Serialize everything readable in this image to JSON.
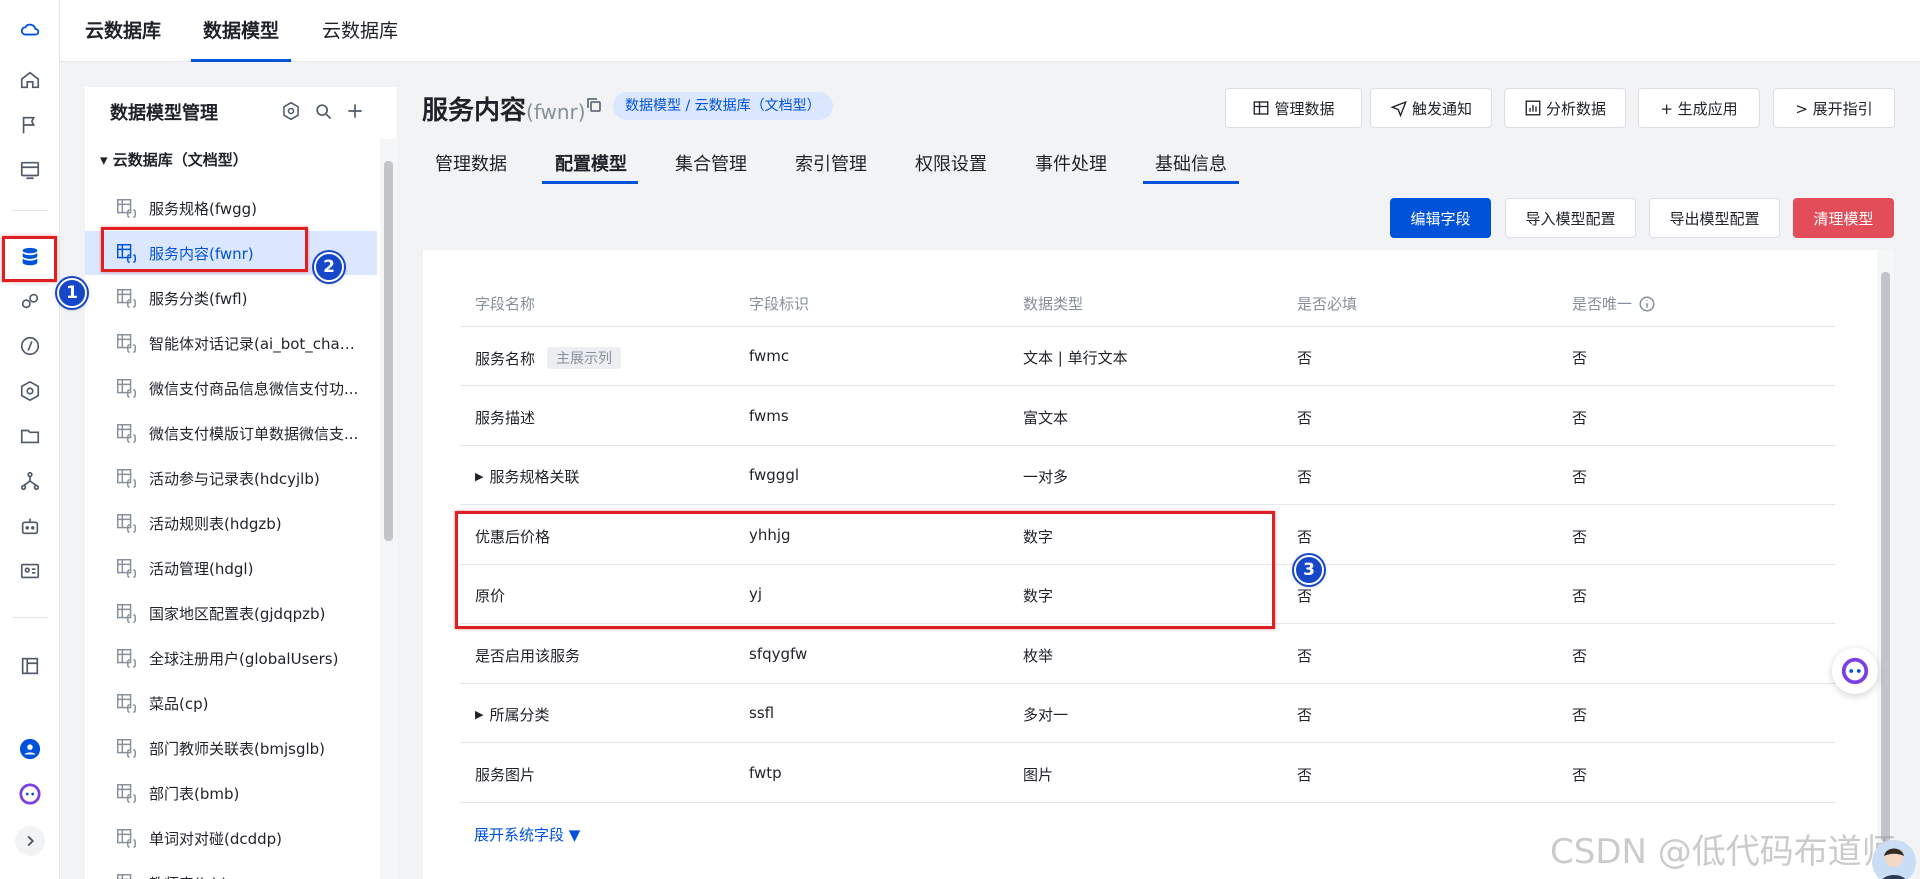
{
  "topbar": {
    "tabs": [
      {
        "label": "云数据库",
        "bold": true
      },
      {
        "label": "数据模型",
        "active": true
      },
      {
        "label": "云数据库"
      }
    ]
  },
  "tree": {
    "title": "数据模型管理",
    "root": "云数据库（文档型）",
    "items": [
      {
        "label": "服务规格(fwgg)"
      },
      {
        "label": "服务内容(fwnr)",
        "selected": true
      },
      {
        "label": "服务分类(fwfl)"
      },
      {
        "label": "智能体对话记录(ai_bot_chat_..."
      },
      {
        "label": "微信支付商品信息微信支付功..."
      },
      {
        "label": "微信支付模版订单数据微信支..."
      },
      {
        "label": "活动参与记录表(hdcyjlb)"
      },
      {
        "label": "活动规则表(hdgzb)"
      },
      {
        "label": "活动管理(hdgl)"
      },
      {
        "label": "国家地区配置表(gjdqpzb)"
      },
      {
        "label": "全球注册用户(globalUsers)"
      },
      {
        "label": "菜品(cp)"
      },
      {
        "label": "部门教师关联表(bmjsglb)"
      },
      {
        "label": "部门表(bmb)"
      },
      {
        "label": "单词对对碰(dcddp)"
      },
      {
        "label": "教师表(jsb)"
      }
    ]
  },
  "page": {
    "title": "服务内容",
    "subtitle": "(fwnr)",
    "breadcrumb": "数据模型 / 云数据库（文档型）"
  },
  "header_buttons": [
    "管理数据",
    "触发通知",
    "分析数据",
    "+ 生成应用",
    "> 展开指引"
  ],
  "subtabs": [
    "管理数据",
    "配置模型",
    "集合管理",
    "索引管理",
    "权限设置",
    "事件处理",
    "基础信息"
  ],
  "actions": {
    "edit_fields": "编辑字段",
    "import_config": "导入模型配置",
    "export_config": "导出模型配置",
    "clear_model": "清理模型"
  },
  "table": {
    "headers": [
      "字段名称",
      "字段标识",
      "数据类型",
      "是否必填",
      "是否唯一"
    ],
    "rows": [
      {
        "name": "服务名称",
        "tag": "主展示列",
        "id": "fwmc",
        "type": "文本 | 单行文本",
        "required": "否",
        "unique": "否",
        "expandable": false
      },
      {
        "name": "服务描述",
        "tag": "",
        "id": "fwms",
        "type": "富文本",
        "required": "否",
        "unique": "否",
        "expandable": false
      },
      {
        "name": "服务规格关联",
        "tag": "",
        "id": "fwgggl",
        "type": "一对多",
        "required": "否",
        "unique": "否",
        "expandable": true
      },
      {
        "name": "优惠后价格",
        "tag": "",
        "id": "yhhjg",
        "type": "数字",
        "required": "否",
        "unique": "否",
        "expandable": false
      },
      {
        "name": "原价",
        "tag": "",
        "id": "yj",
        "type": "数字",
        "required": "否",
        "unique": "否",
        "expandable": false
      },
      {
        "name": "是否启用该服务",
        "tag": "",
        "id": "sfqygfw",
        "type": "枚举",
        "required": "否",
        "unique": "否",
        "expandable": false
      },
      {
        "name": "所属分类",
        "tag": "",
        "id": "ssfl",
        "type": "多对一",
        "required": "否",
        "unique": "否",
        "expandable": true
      },
      {
        "name": "服务图片",
        "tag": "",
        "id": "fwtp",
        "type": "图片",
        "required": "否",
        "unique": "否",
        "expandable": false
      }
    ],
    "expand_system_fields": "展开系统字段 ▼"
  },
  "annotations": [
    "1",
    "2",
    "3"
  ],
  "watermark": "CSDN @低代码布道师",
  "colors": {
    "accent": "#0052d9",
    "danger": "#e34d59",
    "annotation_box": "#e02020",
    "annotation_badge": "#1747c9"
  }
}
